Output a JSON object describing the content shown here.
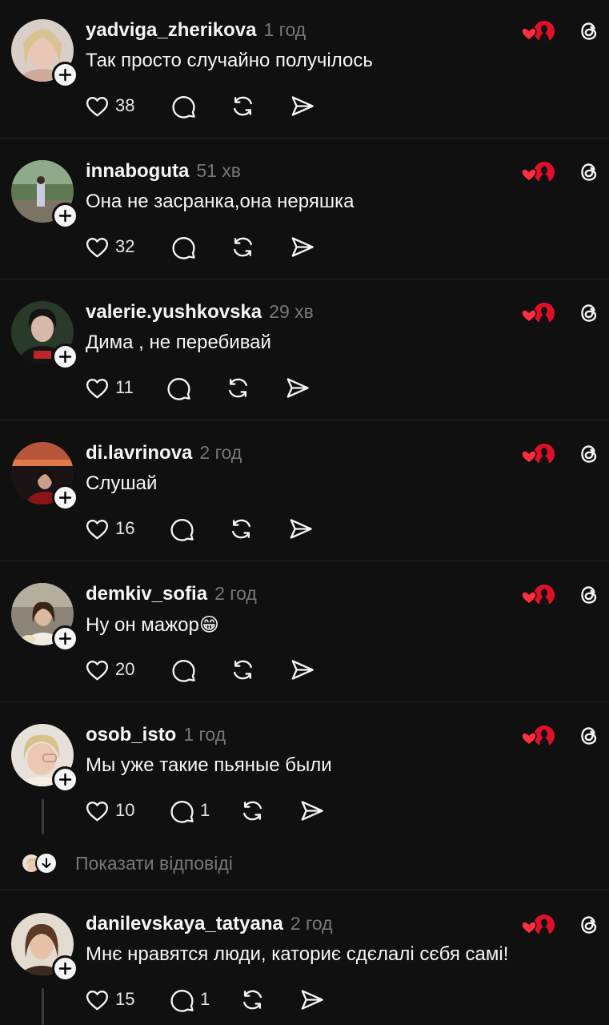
{
  "comments": [
    {
      "username": "yadviga_zherikova",
      "time": "1 год",
      "text": "Так просто случайно получілось",
      "likes": "38",
      "replies": ""
    },
    {
      "username": "innaboguta",
      "time": "51 хв",
      "text": "Она не засранка,она неряшка",
      "likes": "32",
      "replies": ""
    },
    {
      "username": "valerie.yushkovska",
      "time": "29 хв",
      "text": "Дима , не перебивай",
      "likes": "11",
      "replies": ""
    },
    {
      "username": "di.lavrinova",
      "time": "2 год",
      "text": "Слушай",
      "likes": "16",
      "replies": ""
    },
    {
      "username": "demkiv_sofia",
      "time": "2 год",
      "text": "Ну он мажор😁",
      "likes": "20",
      "replies": ""
    },
    {
      "username": "osob_isto",
      "time": "1 год",
      "text": "Мы уже такие пьяные были",
      "likes": "10",
      "replies": "1"
    },
    {
      "username": "danilevskaya_tatyana",
      "time": "2 год",
      "text": "Мнє нравятся люди, каториє сдєлалі сєбя самі!",
      "likes": "15",
      "replies": "1"
    }
  ],
  "show_replies": {
    "label": "Показати відповіді"
  },
  "colors": {
    "background": "#101010",
    "text": "#f3f5f7",
    "muted": "#777777",
    "heart_red": "#ff3040",
    "divider": "#2a2a2a"
  }
}
